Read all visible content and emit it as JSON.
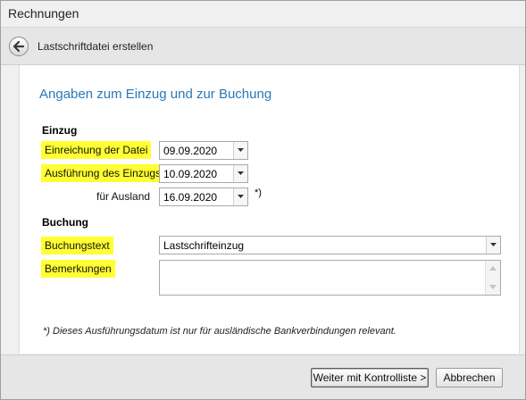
{
  "window": {
    "title": "Rechnungen"
  },
  "nav": {
    "title": "Lastschriftdatei erstellen",
    "back_icon": "back-arrow-icon"
  },
  "main": {
    "heading": "Angaben zum Einzug und zur Buchung",
    "einzug": {
      "group_label": "Einzug",
      "fields": [
        {
          "label": "Einreichung der Datei",
          "value": "09.09.2020"
        },
        {
          "label": "Ausführung des Einzugs",
          "value": "10.09.2020"
        },
        {
          "label": "für Ausland",
          "value": "16.09.2020",
          "mark": "*)"
        }
      ]
    },
    "buchung": {
      "group_label": "Buchung",
      "buchungstext_label": "Buchungstext",
      "buchungstext_value": "Lastschrifteinzug",
      "bemerkungen_label": "Bemerkungen",
      "bemerkungen_value": ""
    },
    "footnote": "*) Dieses Ausführungsdatum ist nur für ausländische Bankverbindungen relevant."
  },
  "footer": {
    "next_label": "Weiter mit Kontrolliste >",
    "cancel_label": "Abbrechen"
  },
  "colors": {
    "heading": "#2a78b8",
    "highlight": "#ffff33"
  }
}
